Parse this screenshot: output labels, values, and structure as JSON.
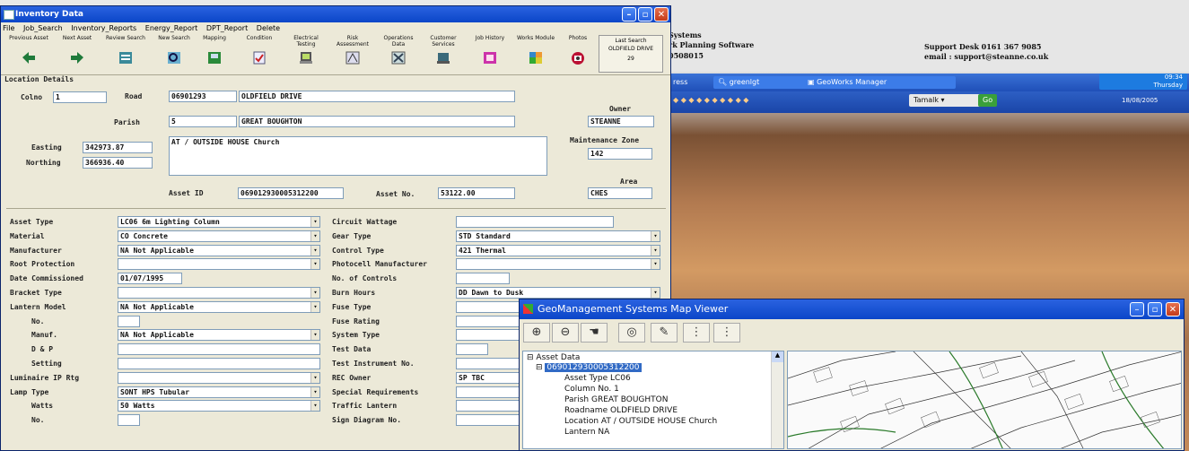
{
  "background": {
    "web_lines": [
      "Systems",
      "rk Planning Software",
      "0508015"
    ],
    "support_line1": "Support Desk 0161 367 9085",
    "support_line2": "email : support@steanne.co.uk",
    "taskbar_items": [
      "ress",
      "greenlgt",
      "GeoWorks Manager"
    ],
    "tray_time": "09:34",
    "tray_day": "Thursday",
    "tray_date": "18/08/2005",
    "lang_button": "Tamalk",
    "go_label": "Go"
  },
  "inventory": {
    "title": "Inventory Data",
    "menu": [
      "File",
      "Job_Search",
      "Inventory_Reports",
      "Energy_Report",
      "DPT_Report",
      "Delete"
    ],
    "toolbar": [
      {
        "label": "Previous Asset",
        "icon": "arrow-left-icon"
      },
      {
        "label": "Next Asset",
        "icon": "arrow-right-icon"
      },
      {
        "label": "Review Search",
        "icon": "review-search-icon"
      },
      {
        "label": "New Search",
        "icon": "new-search-icon"
      },
      {
        "label": "Mapping",
        "icon": "mapping-icon"
      },
      {
        "label": "Condition",
        "icon": "condition-icon"
      },
      {
        "label": "Electrical Testing",
        "icon": "electrical-icon"
      },
      {
        "label": "Risk Assessment",
        "icon": "risk-icon"
      },
      {
        "label": "Operations Data",
        "icon": "operations-icon"
      },
      {
        "label": "Customer Services",
        "icon": "customer-icon"
      },
      {
        "label": "Job History",
        "icon": "job-history-icon"
      },
      {
        "label": "Works Module",
        "icon": "works-icon"
      },
      {
        "label": "Photos",
        "icon": "camera-icon"
      }
    ],
    "last_search": {
      "label": "Last Search",
      "value": "OLDFIELD DRIVE",
      "count": "29"
    },
    "location_details_label": "Location Details",
    "location": {
      "colno_label": "Colno",
      "colno": "1",
      "road_label": "Road",
      "road_code": "06901293",
      "road_name": "OLDFIELD DRIVE",
      "parish_label": "Parish",
      "parish_code": "5",
      "parish_name": "GREAT BOUGHTON",
      "owner_label": "Owner",
      "owner": "STEANNE",
      "easting_label": "Easting",
      "easting": "342973.87",
      "northing_label": "Northing",
      "northing": "366936.40",
      "location_text": "AT / OUTSIDE HOUSE Church",
      "maint_zone_label": "Maintenance Zone",
      "maint_zone": "142",
      "area_label": "Area",
      "area": "CHES",
      "asset_id_label": "Asset ID",
      "asset_id": "069012930005312200",
      "asset_no_label": "Asset No.",
      "asset_no": "53122.00"
    },
    "left_fields": [
      {
        "label": "Asset Type",
        "value": "LC06  6m Lighting Column",
        "combo": true
      },
      {
        "label": "Material",
        "value": "CO    Concrete",
        "combo": true
      },
      {
        "label": "Manufacturer",
        "value": "NA    Not Applicable",
        "combo": true
      },
      {
        "label": "Root Protection",
        "value": "",
        "combo": true
      },
      {
        "label": "Date Commissioned",
        "value": "01/07/1995",
        "combo": false
      },
      {
        "label": "Bracket Type",
        "value": "",
        "combo": true
      },
      {
        "label": "Lantern Model",
        "value": "NA    Not Applicable",
        "combo": true
      },
      {
        "label": "No.",
        "value": "",
        "combo": false
      },
      {
        "label": "Manuf.",
        "value": "NA    Not Applicable",
        "combo": true
      },
      {
        "label": "D & P",
        "value": "",
        "combo": false
      },
      {
        "label": "Setting",
        "value": "",
        "combo": false
      },
      {
        "label": "Luminaire IP Rtg",
        "value": "",
        "combo": true
      },
      {
        "label": "Lamp Type",
        "value": "SONT HPS Tubular",
        "combo": true
      },
      {
        "label": "Watts",
        "value": "50    Watts",
        "combo": true
      },
      {
        "label": "No.",
        "value": "",
        "combo": false
      }
    ],
    "right_fields": [
      {
        "label": "Circuit Wattage",
        "value": "",
        "combo": false
      },
      {
        "label": "Gear Type",
        "value": "STD   Standard",
        "combo": true
      },
      {
        "label": "Control Type",
        "value": "421   Thermal",
        "combo": true
      },
      {
        "label": "Photocell Manufacturer",
        "value": "",
        "combo": true
      },
      {
        "label": "No. of Controls",
        "value": "",
        "combo": false
      },
      {
        "label": "Burn Hours",
        "value": "DD    Dawn to Dusk",
        "combo": true
      },
      {
        "label": "Fuse Type",
        "value": "",
        "combo": false
      },
      {
        "label": "Fuse Rating",
        "value": "",
        "combo": false
      },
      {
        "label": "System Type",
        "value": "",
        "combo": false
      },
      {
        "label": "Test Data",
        "value": "",
        "combo": false
      },
      {
        "label": "Test Instrument No.",
        "value": "",
        "combo": false
      },
      {
        "label": "REC Owner",
        "value": "SP    TBC",
        "combo": false
      },
      {
        "label": "Special Requirements",
        "value": "",
        "combo": false
      },
      {
        "label": "Traffic Lantern",
        "value": "",
        "combo": false
      },
      {
        "label": "Sign Diagram No.",
        "value": "",
        "combo": false
      }
    ]
  },
  "mapviewer": {
    "title": "GeoManagement Systems Map Viewer",
    "tools": [
      "zoom-in-icon",
      "zoom-out-icon",
      "pan-hand-icon",
      "zoom-extent-icon",
      "identify-icon",
      "add-node-icon",
      "remove-node-icon"
    ],
    "tree": {
      "root": "Asset Data",
      "asset": "069012930005312200",
      "items": [
        "Asset Type LC06",
        "Column No. 1",
        "Parish GREAT BOUGHTON",
        "Roadname OLDFIELD DRIVE",
        "Location AT / OUTSIDE HOUSE Church",
        "Lantern NA"
      ]
    }
  }
}
